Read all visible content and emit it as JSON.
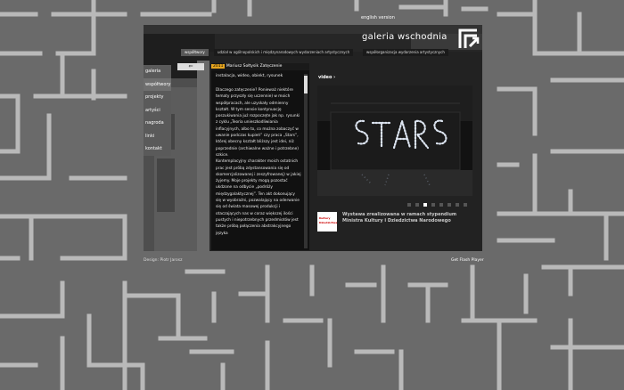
{
  "header": {
    "lang_link": "english version",
    "logo_text": "galeria wschodnia"
  },
  "tabs": [
    {
      "label": "współtwory",
      "active": true
    },
    {
      "label": "udział w ogólnopolskich i międzynarodowych wydarzeniach artystycznych",
      "active": false
    },
    {
      "label": "współorganizacja wydarzenia artystycznych",
      "active": false
    }
  ],
  "menu": [
    {
      "label": "galeria",
      "active": false
    },
    {
      "label": "współtwory",
      "active": true
    },
    {
      "label": "projekty",
      "active": false
    },
    {
      "label": "artyści",
      "active": false
    },
    {
      "label": "nagroda",
      "active": false
    },
    {
      "label": "linki",
      "active": false
    },
    {
      "label": "kontakt",
      "active": false
    }
  ],
  "back_arrow": "⇐",
  "article": {
    "year": "2011",
    "author": "Mariusz Sołtysik",
    "title": "Zatęczenie",
    "tags": "instalacja, wideo, obiekt, rysunek",
    "paragraphs": [
      "Dlaczego zatęczenie? Ponieważ niektóre tematy przyszły się uczennie) w moich współpracach, ale uzyskały odmienny kształt. W tym sensie kontynuację poszukiwania już rozpoczęte jak np. rysunki z cyklu „Teoria unieszkodliwiania inflacyjnych, albo to, co można zobaczyć w uwanie podczas kupień” czy praca „Stars”, której obecny kształt bliższy jest idei, niż poprzednie (archiwalne ważne i potrzebne) szkice.",
      "Kontemplacyjny charakter moich ostatnich prac jest próbą zdystansowania się od skomercjalizowanej i zeszyfrowanej) w jakiej żyjemy. Moje projekty mogą pozostać ukdzone na odbycie „podróży międzygalaktycznej”. Ten akt dokonujący się w wyobraźni, pozwalający na oderwanie się od świata masowej produkcji i otaczających nas w coraz większej ilości pustych i niepotrzebnych przedmiotów jest także próbą połączenia abstrakcyjnego języka"
    ]
  },
  "video": {
    "label": "video ›",
    "dots": 8,
    "active_dot": 2
  },
  "sponsor": {
    "logo_line1": "Kultury",
    "logo_line2": "Dziedzictwa",
    "text": "Wystawa zrealizowana w ramach stypendium Ministra Kultury i Dziedzictwa Narodowego"
  },
  "footer": {
    "left": "Design: Piotr Jarosz",
    "right": "Get Flash Player"
  },
  "colors": {
    "background": "#6a6a6a",
    "walls": "#b9b9b9",
    "year_badge": "#e6a51f"
  },
  "icons": [
    "logo-arrow-icon",
    "back-arrow-icon",
    "scroll-thumb"
  ]
}
